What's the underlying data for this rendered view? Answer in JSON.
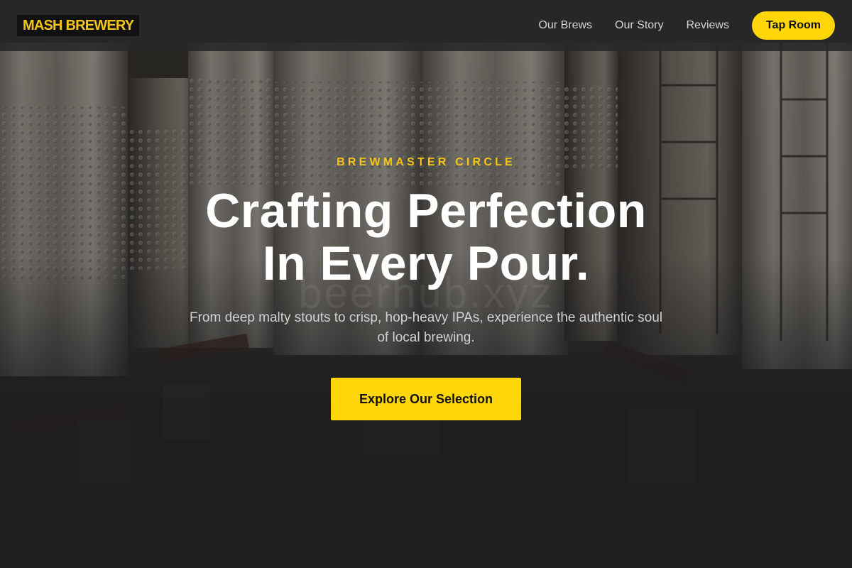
{
  "nav": {
    "logo": "MASH BREWERY",
    "links": [
      "Our Brews",
      "Our Story",
      "Reviews"
    ],
    "cta": "Tap Room"
  },
  "hero": {
    "eyebrow": "BREWMASTER CIRCLE",
    "headline_line1": "Crafting Perfection",
    "headline_line2": "In Every Pour.",
    "subtext": "From deep malty stouts to crisp, hop-heavy IPAs, experience the authentic soul of local brewing.",
    "button": "Explore Our Selection",
    "watermark": "beerhub.xyz"
  },
  "colors": {
    "accent": "#ffd60a",
    "navbar": "#282828",
    "background": "#1c1c1c",
    "headline": "#ffffff"
  }
}
